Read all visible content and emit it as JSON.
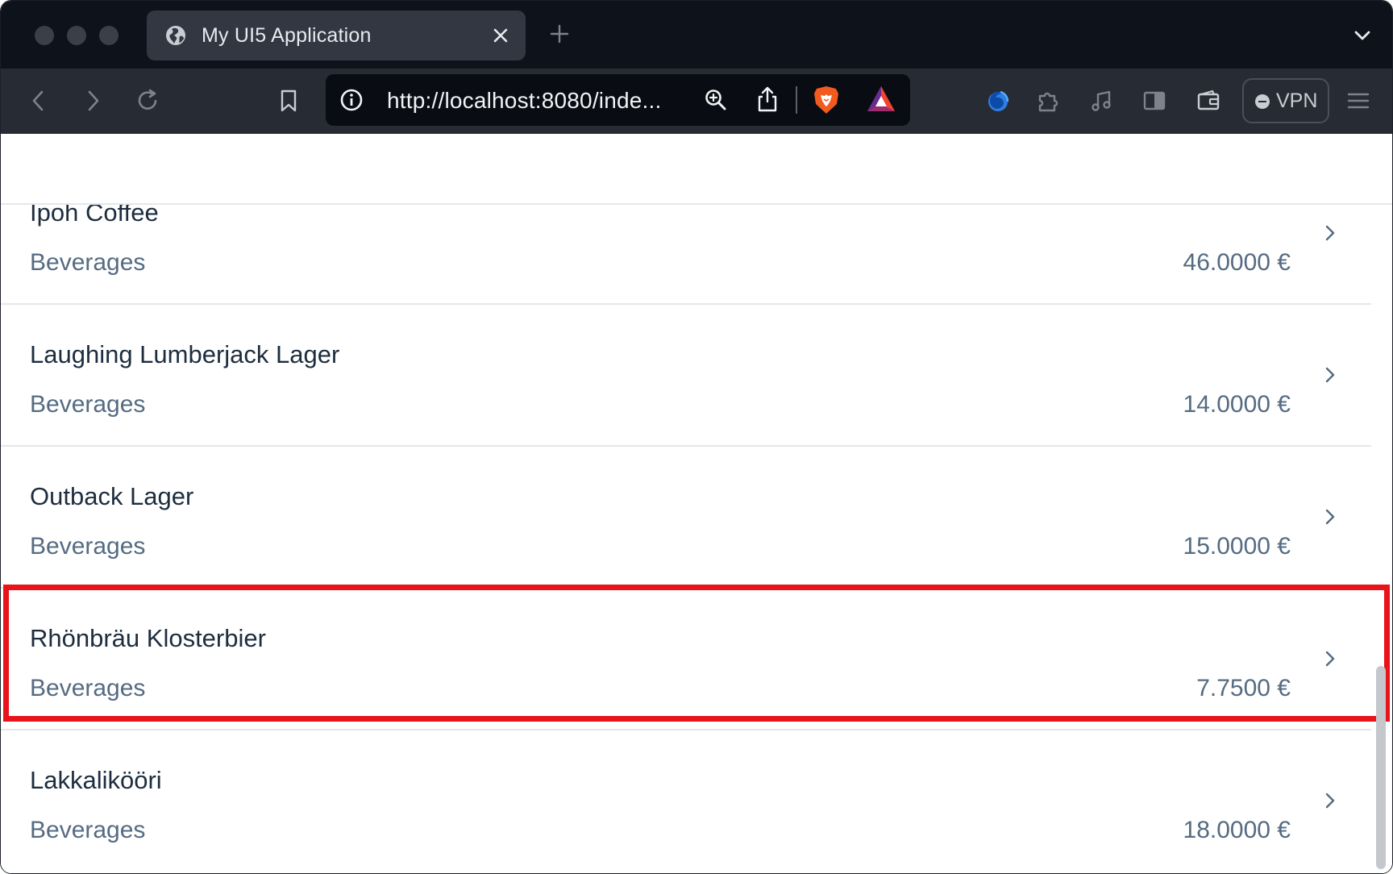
{
  "browser": {
    "tab": {
      "title": "My UI5 Application"
    },
    "url": "http://localhost:8080/inde...",
    "vpn_label": "VPN"
  },
  "products": [
    {
      "name": "Ipoh Coffee",
      "category": "Beverages",
      "price": "46.0000 €"
    },
    {
      "name": "Laughing Lumberjack Lager",
      "category": "Beverages",
      "price": "14.0000 €"
    },
    {
      "name": "Outback Lager",
      "category": "Beverages",
      "price": "15.0000 €"
    },
    {
      "name": "Rhönbräu Klosterbier",
      "category": "Beverages",
      "price": "7.7500 €"
    },
    {
      "name": "Lakkalikööri",
      "category": "Beverages",
      "price": "18.0000 €"
    }
  ],
  "highlight_color": "#e8141a"
}
